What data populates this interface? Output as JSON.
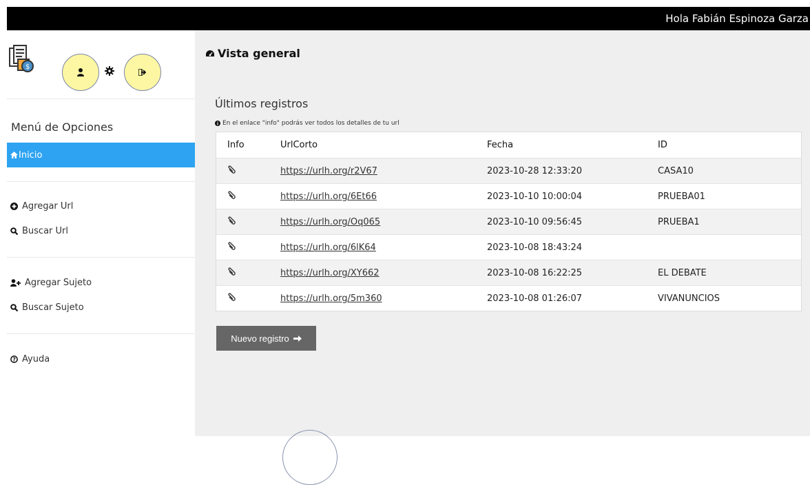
{
  "header": {
    "greeting": "Hola Fabián Espinoza Garza"
  },
  "sidebar": {
    "menu_title": "Menú de Opciones",
    "items": [
      {
        "label": "Inicio",
        "icon": "home-icon",
        "active": true
      },
      {
        "label": "Agregar Url",
        "icon": "plus-circle-icon"
      },
      {
        "label": "Buscar Url",
        "icon": "search-icon"
      },
      {
        "label": "Agregar Sujeto",
        "icon": "user-plus-icon"
      },
      {
        "label": "Buscar Sujeto",
        "icon": "search-icon"
      },
      {
        "label": "Ayuda",
        "icon": "help-circle-icon"
      }
    ]
  },
  "main": {
    "section_title": "Vista general",
    "records_title": "Últimos registros",
    "hint": "En el enlace \"info\" podrás ver todos los detalles de tu url",
    "table": {
      "headers": [
        "Info",
        "UrlCorto",
        "Fecha",
        "ID"
      ],
      "rows": [
        {
          "url": "https://urlh.org/r2V67",
          "fecha": "2023-10-28 12:33:20",
          "id": "CASA10"
        },
        {
          "url": "https://urlh.org/6Et66",
          "fecha": "2023-10-10 10:00:04",
          "id": "PRUEBA01"
        },
        {
          "url": "https://urlh.org/Oq065",
          "fecha": "2023-10-10 09:56:45",
          "id": "PRUEBA1"
        },
        {
          "url": "https://urlh.org/6lK64",
          "fecha": "2023-10-08 18:43:24",
          "id": ""
        },
        {
          "url": "https://urlh.org/XY662",
          "fecha": "2023-10-08 16:22:25",
          "id": "EL DEBATE"
        },
        {
          "url": "https://urlh.org/5m360",
          "fecha": "2023-10-08 01:26:07",
          "id": "VIVANUNCIOS"
        }
      ]
    },
    "new_button": "Nuevo registro"
  },
  "colors": {
    "topbar": "#000000",
    "active_item": "#2ea3f2",
    "circle_fill": "#fdf7a3",
    "button": "#666666",
    "main_bg": "#efefef"
  }
}
